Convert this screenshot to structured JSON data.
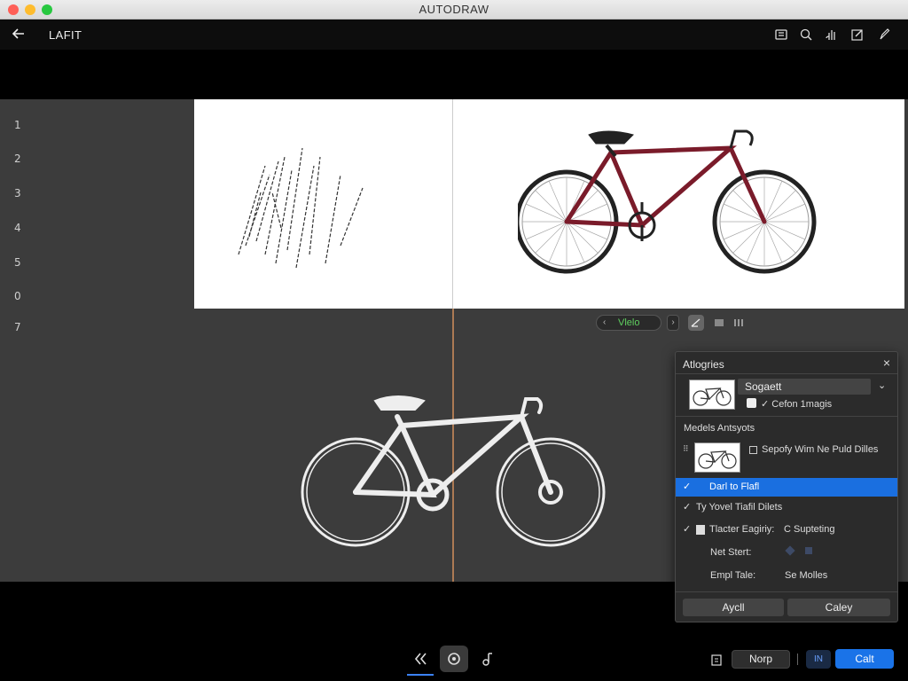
{
  "window": {
    "title": "AUTODRAW"
  },
  "appbar": {
    "back_icon": "arrow-left-icon",
    "doc_name": "LAFIT",
    "tools": [
      "layers-icon",
      "search-zoom-icon",
      "hand-icon",
      "edit-pen-icon",
      "pencil-icon"
    ]
  },
  "gutter": {
    "numbers": [
      "1",
      "2",
      "3",
      "4",
      "5",
      "0",
      "7"
    ]
  },
  "mini_toolbar": {
    "prev": "‹",
    "label": "Vlelo",
    "next": "›"
  },
  "panel": {
    "title": "Atlogries",
    "close": "×",
    "select_value": "Sogaett",
    "checkbox_label": "✓ Cefon 1magis",
    "section_label": "Medels Antsyots",
    "model_label": "Sepofy Wim Ne Puld Dilles",
    "rows": [
      {
        "tick": "✓",
        "label": "Darl to Flafl",
        "selected": true
      },
      {
        "tick": "✓",
        "label": "Ty Yovel Tiafil Dilets",
        "selected": false
      },
      {
        "tick": "✓",
        "label": "Tlacter Eagiriy:",
        "value": "C Supteting",
        "selected": false
      }
    ],
    "kv": [
      {
        "key": "Net Stert:",
        "value": ""
      },
      {
        "key": "Empl Tale:",
        "value": "Se Molles"
      }
    ],
    "apply": "Aycll",
    "cancel": "Caley"
  },
  "bottom": {
    "icons": [
      "rewind-icon",
      "record-icon",
      "music-note-icon"
    ],
    "left_icon": "clipboard-icon",
    "norp": "Norp",
    "small": "IN",
    "calt": "Calt"
  },
  "colors": {
    "accent": "#1a73e8",
    "bike_red": "#7a1b2a",
    "status_green": "#5fcf5f"
  }
}
